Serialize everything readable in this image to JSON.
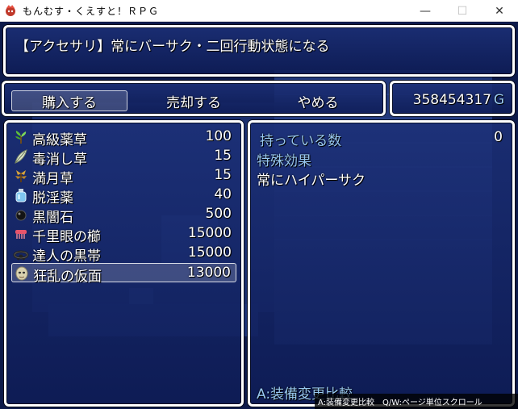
{
  "window": {
    "title": "もんむす・くえすと！ＲＰＧ",
    "minimize": "—",
    "maximize": "☐",
    "close": "✕"
  },
  "help": {
    "text": "【アクセサリ】常にバーサク・二回行動状態になる"
  },
  "commands": [
    {
      "label": "購入する",
      "selected": true
    },
    {
      "label": "売却する",
      "selected": false
    },
    {
      "label": "やめる",
      "selected": false
    }
  ],
  "gold": {
    "value": "358454317",
    "unit": "G"
  },
  "items": [
    {
      "name": "高級薬草",
      "price": "100",
      "icon": "herb-icon"
    },
    {
      "name": "毒消し草",
      "price": "15",
      "icon": "leaf-icon"
    },
    {
      "name": "満月草",
      "price": "15",
      "icon": "moon-grass-icon"
    },
    {
      "name": "脱淫薬",
      "price": "40",
      "icon": "potion-bottle-icon"
    },
    {
      "name": "黒闇石",
      "price": "500",
      "icon": "black-stone-icon"
    },
    {
      "name": "千里眼の櫛",
      "price": "15000",
      "icon": "comb-icon"
    },
    {
      "name": "達人の黒帯",
      "price": "15000",
      "icon": "black-belt-icon"
    },
    {
      "name": "狂乱の仮面",
      "price": "13000",
      "icon": "mask-icon",
      "selected": true
    }
  ],
  "status": {
    "possession_label": "持っている数",
    "possession_value": "0",
    "effect_label": "特殊効果",
    "effect_text": "常にハイパーサク",
    "compare_hint": "A:装備変更比較"
  },
  "hint_bar": {
    "text": "A:装備変更比較　Q/W:ページ単位スクロール"
  }
}
